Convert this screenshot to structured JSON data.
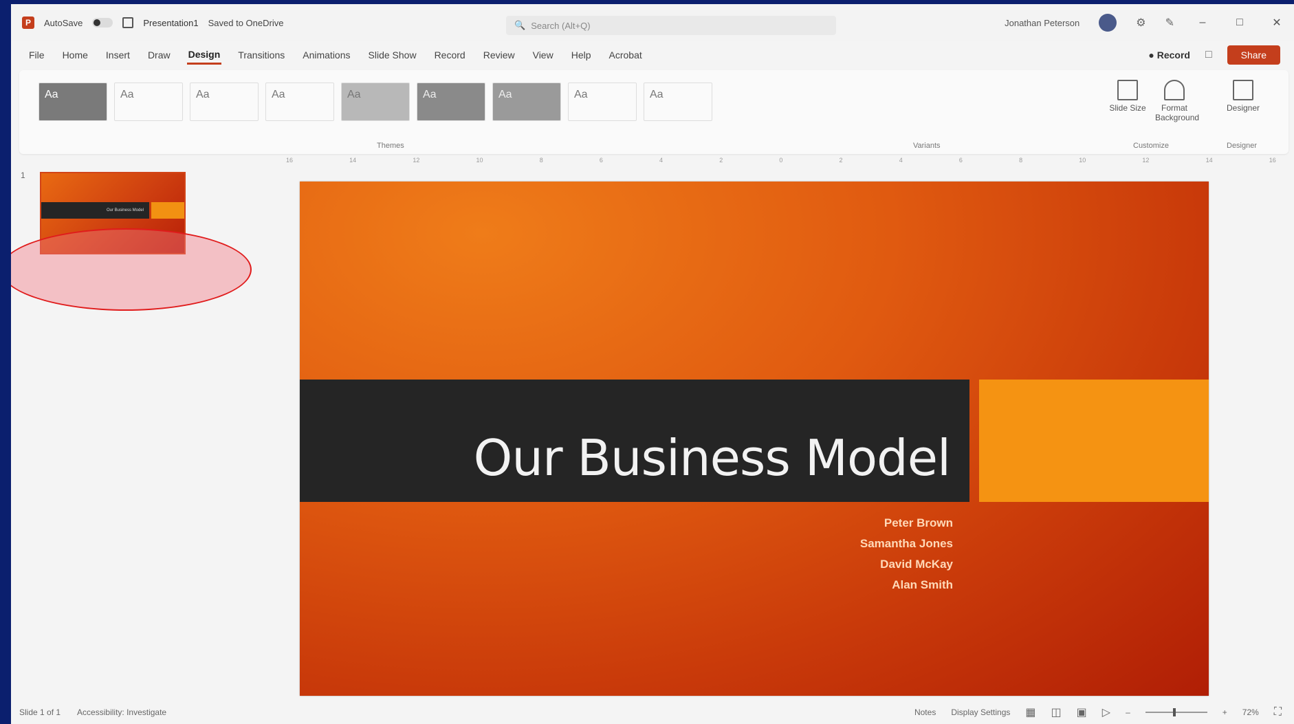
{
  "window": {
    "autosave_label": "AutoSave",
    "doc_title": "Presentation1",
    "doc_status": "Saved to OneDrive",
    "search_placeholder": "Search (Alt+Q)",
    "user_name": "Jonathan Peterson"
  },
  "menu": {
    "tabs": [
      "File",
      "Home",
      "Insert",
      "Draw",
      "Design",
      "Transitions",
      "Animations",
      "Slide Show",
      "Record",
      "Review",
      "View",
      "Help",
      "Acrobat"
    ],
    "active_index": 4,
    "record_label": "Record",
    "share_label": "Share"
  },
  "ribbon": {
    "themes": [
      "Aa",
      "Aa",
      "Aa",
      "Aa",
      "Aa",
      "Aa",
      "Aa",
      "Aa",
      "Aa"
    ],
    "groups": {
      "themes_label": "Themes",
      "variants_label": "Variants",
      "customize_label": "Customize",
      "designer_label": "Designer"
    },
    "buttons": {
      "slide_size": "Slide Size",
      "format_background": "Format Background",
      "designer": "Designer"
    }
  },
  "slides_panel": {
    "slide_number": "1",
    "thumb_title": "Our Business Model"
  },
  "slide": {
    "title": "Our Business Model",
    "names": [
      "Peter Brown",
      "Samantha Jones",
      "David McKay",
      "Alan Smith"
    ]
  },
  "status": {
    "slide_info": "Slide 1 of 1",
    "accessibility": "Accessibility: Investigate",
    "notes": "Notes",
    "display_settings": "Display Settings",
    "zoom": "72%"
  },
  "colors": {
    "accent": "#c43e1c",
    "slide_orange": "#e05a10",
    "band_dark": "#252525",
    "accent_rect": "#f59312",
    "annotation": "#e01b1b",
    "frame": "#0b1f6e"
  }
}
